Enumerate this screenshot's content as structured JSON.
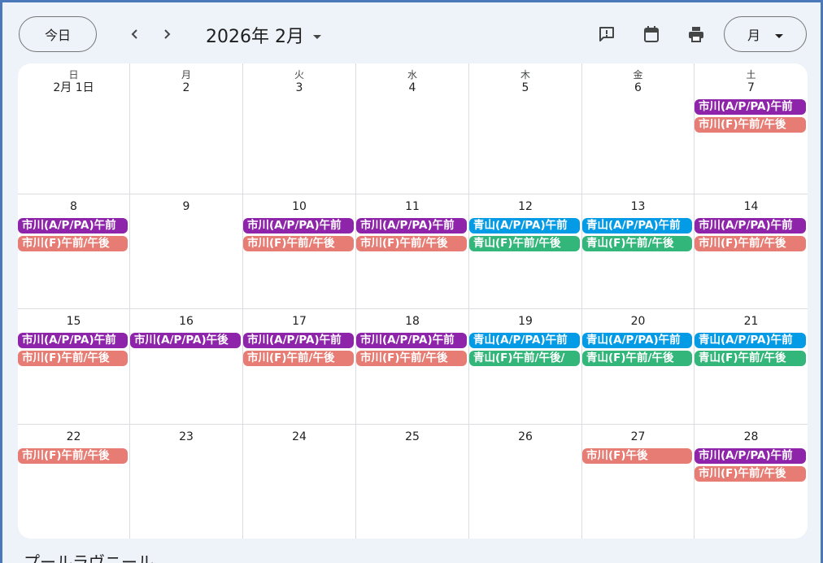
{
  "toolbar": {
    "today_label": "今日",
    "prev_icon": "chevron-left-icon",
    "next_icon": "chevron-right-icon",
    "month_title": "2026年 2月",
    "view_label": "月",
    "icons": [
      "feedback-icon",
      "calendar-icon",
      "print-icon"
    ]
  },
  "colors": {
    "purple": "#8e24aa",
    "salmon": "#e67c73",
    "blue": "#039be5",
    "green": "#33b679"
  },
  "weeks": [
    {
      "days": [
        {
          "dow": "日",
          "num": "2月 1日",
          "events": []
        },
        {
          "dow": "月",
          "num": "2",
          "events": []
        },
        {
          "dow": "火",
          "num": "3",
          "events": []
        },
        {
          "dow": "水",
          "num": "4",
          "events": []
        },
        {
          "dow": "木",
          "num": "5",
          "events": []
        },
        {
          "dow": "金",
          "num": "6",
          "events": []
        },
        {
          "dow": "土",
          "num": "7",
          "events": [
            {
              "title": "市川(A/P/PA)午前",
              "color": "purple"
            },
            {
              "title": "市川(F)午前/午後",
              "color": "salmon"
            }
          ]
        }
      ]
    },
    {
      "days": [
        {
          "num": "8",
          "events": [
            {
              "title": "市川(A/P/PA)午前",
              "color": "purple"
            },
            {
              "title": "市川(F)午前/午後",
              "color": "salmon"
            }
          ]
        },
        {
          "num": "9",
          "events": []
        },
        {
          "num": "10",
          "events": [
            {
              "title": "市川(A/P/PA)午前",
              "color": "purple"
            },
            {
              "title": "市川(F)午前/午後",
              "color": "salmon"
            }
          ]
        },
        {
          "num": "11",
          "events": [
            {
              "title": "市川(A/P/PA)午前",
              "color": "purple"
            },
            {
              "title": "市川(F)午前/午後",
              "color": "salmon"
            }
          ]
        },
        {
          "num": "12",
          "events": [
            {
              "title": "青山(A/P/PA)午前",
              "color": "blue"
            },
            {
              "title": "青山(F)午前/午後",
              "color": "green"
            }
          ]
        },
        {
          "num": "13",
          "events": [
            {
              "title": "青山(A/P/PA)午前",
              "color": "blue"
            },
            {
              "title": "青山(F)午前/午後",
              "color": "green"
            }
          ]
        },
        {
          "num": "14",
          "events": [
            {
              "title": "市川(A/P/PA)午前",
              "color": "purple"
            },
            {
              "title": "市川(F)午前/午後",
              "color": "salmon"
            }
          ]
        }
      ]
    },
    {
      "days": [
        {
          "num": "15",
          "events": [
            {
              "title": "市川(A/P/PA)午前",
              "color": "purple"
            },
            {
              "title": "市川(F)午前/午後",
              "color": "salmon"
            }
          ]
        },
        {
          "num": "16",
          "events": [
            {
              "title": "市川(A/P/PA)午後",
              "color": "purple"
            }
          ]
        },
        {
          "num": "17",
          "events": [
            {
              "title": "市川(A/P/PA)午前",
              "color": "purple"
            },
            {
              "title": "市川(F)午前/午後",
              "color": "salmon"
            }
          ]
        },
        {
          "num": "18",
          "events": [
            {
              "title": "市川(A/P/PA)午前",
              "color": "purple"
            },
            {
              "title": "市川(F)午前/午後",
              "color": "salmon"
            }
          ]
        },
        {
          "num": "19",
          "events": [
            {
              "title": "青山(A/P/PA)午前",
              "color": "blue"
            },
            {
              "title": "青山(F)午前/午後/",
              "color": "green"
            }
          ]
        },
        {
          "num": "20",
          "events": [
            {
              "title": "青山(A/P/PA)午前",
              "color": "blue"
            },
            {
              "title": "青山(F)午前/午後",
              "color": "green"
            }
          ]
        },
        {
          "num": "21",
          "events": [
            {
              "title": "青山(A/P/PA)午前",
              "color": "blue"
            },
            {
              "title": "青山(F)午前/午後",
              "color": "green"
            }
          ]
        }
      ]
    },
    {
      "days": [
        {
          "num": "22",
          "events": [
            {
              "title": "市川(F)午前/午後",
              "color": "salmon"
            }
          ]
        },
        {
          "num": "23",
          "events": []
        },
        {
          "num": "24",
          "events": []
        },
        {
          "num": "25",
          "events": []
        },
        {
          "num": "26",
          "events": []
        },
        {
          "num": "27",
          "events": [
            {
              "title": "市川(F)午後",
              "color": "salmon"
            }
          ]
        },
        {
          "num": "28",
          "events": [
            {
              "title": "市川(A/P/PA)午前",
              "color": "purple"
            },
            {
              "title": "市川(F)午前/午後",
              "color": "salmon"
            }
          ]
        }
      ]
    }
  ],
  "footer": {
    "title": "プールラヴニール"
  }
}
